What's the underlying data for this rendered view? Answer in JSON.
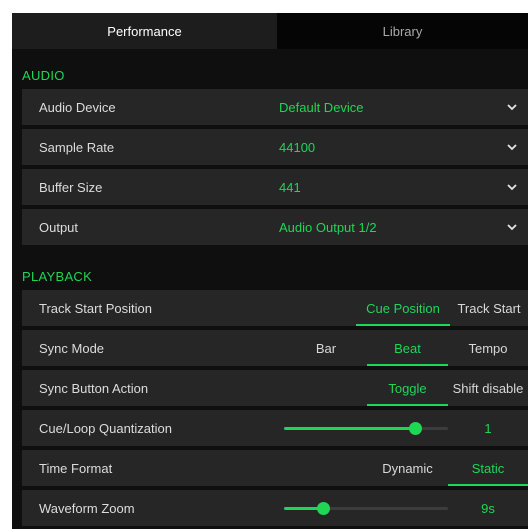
{
  "tabs": [
    {
      "label": "Performance",
      "active": true
    },
    {
      "label": "Library",
      "active": false
    }
  ],
  "colors": {
    "accent": "#1fd655",
    "row_bg": "#262626",
    "panel_bg": "#0f0f0f"
  },
  "audio": {
    "title": "AUDIO",
    "rows": [
      {
        "label": "Audio Device",
        "value": "Default Device",
        "icon": "chevron-down-icon"
      },
      {
        "label": "Sample Rate",
        "value": "44100",
        "icon": "chevron-down-icon"
      },
      {
        "label": "Buffer Size",
        "value": "441",
        "icon": "chevron-down-icon"
      },
      {
        "label": "Output",
        "value": "Audio Output 1/2",
        "icon": "chevron-down-icon"
      }
    ]
  },
  "playback": {
    "title": "PLAYBACK",
    "track_start": {
      "label": "Track Start Position",
      "options": [
        "Cue Position",
        "Track Start"
      ],
      "selected": "Cue Position"
    },
    "sync_mode": {
      "label": "Sync Mode",
      "options": [
        "Bar",
        "Beat",
        "Tempo"
      ],
      "selected": "Beat"
    },
    "sync_button": {
      "label": "Sync Button Action",
      "options": [
        "Toggle",
        "Shift disable"
      ],
      "selected": "Toggle"
    },
    "cue_loop": {
      "label": "Cue/Loop Quantization",
      "value": "1",
      "level": 0.8
    },
    "time_format": {
      "label": "Time Format",
      "options": [
        "Dynamic",
        "Static"
      ],
      "selected": "Static"
    },
    "waveform_zoom": {
      "label": "Waveform Zoom",
      "value": "9s",
      "level": 0.24
    }
  }
}
